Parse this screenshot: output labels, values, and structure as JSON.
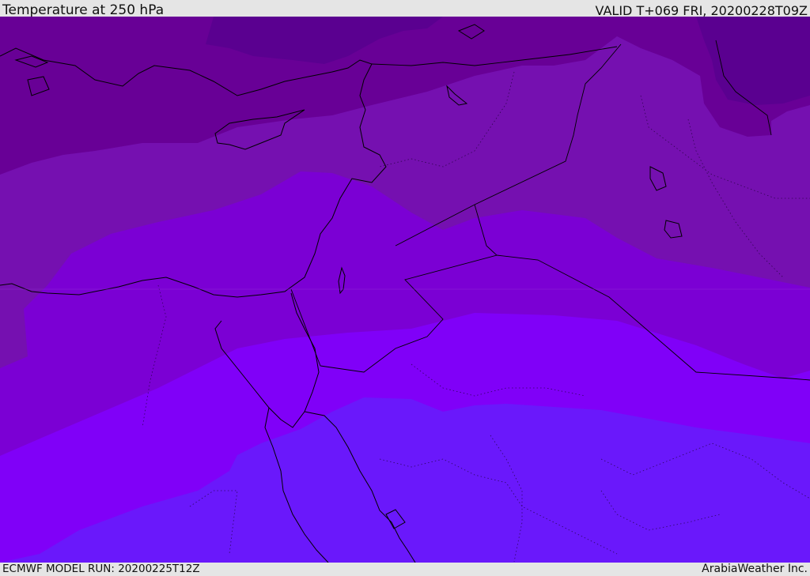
{
  "header": {
    "title": "Temperature at 250 hPa",
    "valid": "VALID T+069 FRI, 20200228T09Z"
  },
  "footer": {
    "model_run": "ECMWF MODEL RUN: 20200225T12Z",
    "credit": "ArabiaWeather Inc."
  },
  "colors": {
    "band_coldest": "#5a0090",
    "band_1": "#680096",
    "band_2": "#7510b0",
    "band_3": "#7b00d4",
    "band_4": "#8000f8",
    "band_5": "#6a18fb",
    "coastline": "#000000"
  }
}
